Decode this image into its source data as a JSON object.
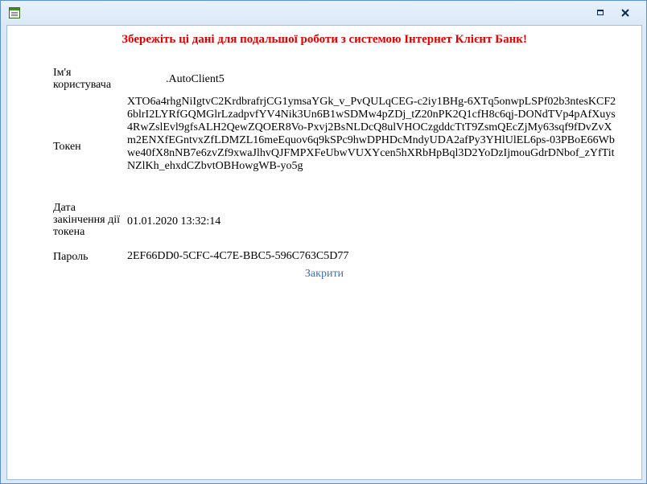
{
  "window": {
    "title": ""
  },
  "dialog": {
    "heading": "Збережіть ці дані для подальшої роботи з системою Інтернет Клієнт Банк!",
    "fields": {
      "username": {
        "label": "Ім'я користувача",
        "value": ".AutoClient5"
      },
      "token": {
        "label": "Токен",
        "value": "XTO6a4rhgNiIgtvC2KrdbrafrjCG1ymsaYGk_v_PvQULqCEG-c2iy1BHg-6XTq5onwpLSPf02b3ntesKCF26blrI2LYRfGQMGlrLzadpvfYV4Nik3Un6B1wSDMw4pZDj_tZ20nPK2Q1cfH8c6qj-DONdTVp4pAfXuys4RwZslEvl9gfsALH2QewZQOER8Vo-Pxvj2BsNLDcQ8ulVHOCzgddcTtT9ZsmQEcZjMy63sqf9fDvZvXm2ENXfEGntvxZfLDMZL16meEquov6q9kSPc9hwDPHDcMndyUDA2afPy3YHlUlEL6ps-03PBoE66Wbwe40fX8nNB7e6zvZf9xwaJlhvQJFMPXFeUbwVUXYcen5hXRbHpBql3D2YoDzIjmouGdrDNbof_zYfTitNZlKh_ehxdCZbvtOBHowgWB-yo5g"
      },
      "expiry": {
        "label": "Дата закінчення дії токена",
        "value": "01.01.2020 13:32:14"
      },
      "password": {
        "label": "Пароль",
        "value": "2EF66DD0-5CFC-4C7E-BBC5-596C763C5D77"
      }
    },
    "close_label": "Закрити"
  },
  "icons": {
    "app": "form-window-icon",
    "maximize": "maximize-icon",
    "close": "close-icon"
  },
  "colors": {
    "heading": "#e00000",
    "link": "#3f6fb5",
    "title_bar": "#dbe9f8",
    "border": "#5b8fd0"
  }
}
